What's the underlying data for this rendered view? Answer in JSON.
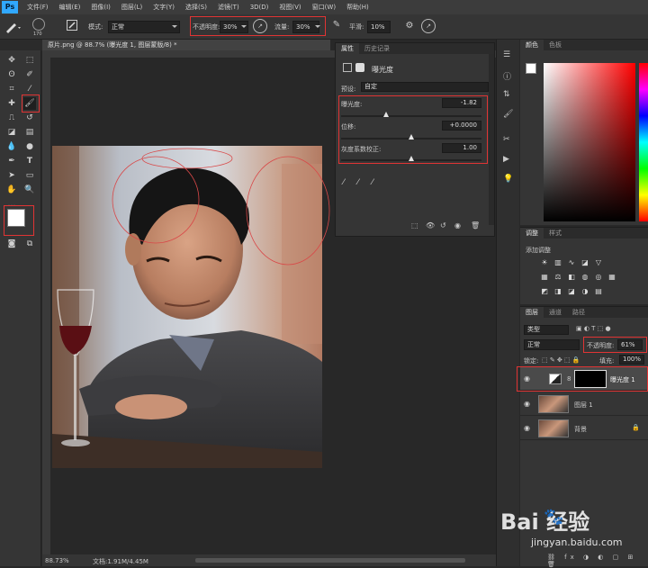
{
  "menu": [
    "文件(F)",
    "编辑(E)",
    "图像(I)",
    "图层(L)",
    "文字(Y)",
    "选择(S)",
    "滤镜(T)",
    "3D(D)",
    "视图(V)",
    "窗口(W)",
    "帮助(H)"
  ],
  "options": {
    "brush_size": "170",
    "mode_label": "模式:",
    "mode_value": "正常",
    "opacity_label": "不透明度:",
    "opacity_value": "30%",
    "flow_label": "流量:",
    "flow_value": "30%",
    "smooth_label": "平滑:",
    "smooth_value": "10%"
  },
  "document": {
    "tab_title": "原片.png @ 88.7% (曝光度 1, 图层蒙版/8) *",
    "zoom": "88.73%",
    "doc_size": "文档:1.91M/4.45M"
  },
  "properties": {
    "tabs": [
      "属性",
      "历史记录"
    ],
    "title": "曝光度",
    "preset_label": "预设:",
    "preset_value": "自定",
    "exposure_label": "曝光度:",
    "exposure_value": "-1.82",
    "offset_label": "位移:",
    "offset_value": "+0.0000",
    "gamma_label": "灰度系数校正:",
    "gamma_value": "1.00",
    "sliders": {
      "exposure": 0.32,
      "offset": 0.5,
      "gamma": 0.5
    }
  },
  "color_panel": {
    "tabs": [
      "颜色",
      "色板"
    ],
    "hue_color": "#ff0000"
  },
  "adjustments": {
    "tabs": [
      "调整",
      "样式"
    ],
    "add_label": "添加调整"
  },
  "layers": {
    "tabs": [
      "图层",
      "通道",
      "路径"
    ],
    "kind_label": "类型",
    "blend_mode": "正常",
    "opacity_label": "不透明度:",
    "opacity_value": "61%",
    "lock_label": "锁定:",
    "fill_label": "填充:",
    "fill_value": "100%",
    "items": [
      {
        "name": "曝光度 1"
      },
      {
        "name": "图层 1"
      },
      {
        "name": "背景"
      }
    ]
  },
  "watermark": {
    "brand": "Bai  经验",
    "url": "jingyan.baidu.com"
  },
  "colors": {
    "accent_red": "#e03434",
    "ps_blue": "#31a8ff"
  }
}
